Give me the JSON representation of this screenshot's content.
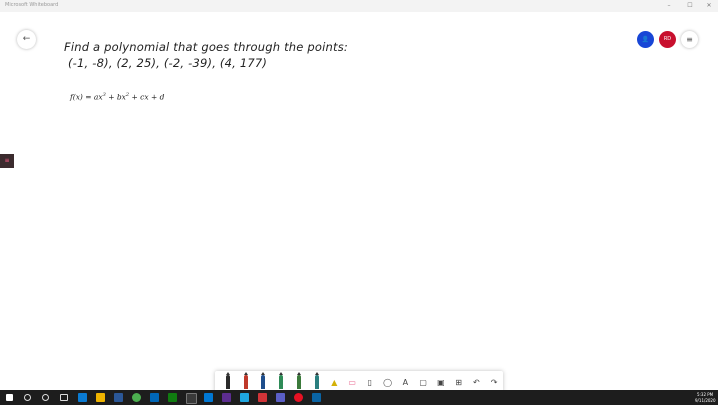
{
  "app": {
    "title": "Microsoft Whiteboard"
  },
  "window_controls": {
    "minimize": "–",
    "maximize": "☐",
    "close": "✕"
  },
  "header": {
    "back_glyph": "←",
    "user_glyph": "👤",
    "user_initials": "RD",
    "menu_glyph": "≡"
  },
  "colors": {
    "user_avatar": "#1846d6",
    "rd_avatar": "#c8102e",
    "taskbar": "#1d1d1d"
  },
  "board": {
    "line1": "Find a polynomial that goes through the points:",
    "line2": "(-1, -8), (2, 25), (-2, -39), (4, 177)",
    "formula_lhs": "f(x) = ax",
    "formula_exp1": "3",
    "formula_mid1": " + bx",
    "formula_exp2": "2",
    "formula_rest": " + cx + d"
  },
  "toolbar": {
    "pens": [
      {
        "name": "pen-black",
        "color": "#2b2b2b"
      },
      {
        "name": "pen-red",
        "color": "#c0392b"
      },
      {
        "name": "pen-blue",
        "color": "#1f4e8c"
      },
      {
        "name": "pen-green",
        "color": "#2e8b57"
      },
      {
        "name": "pen-darkgreen",
        "color": "#3b7a3b"
      },
      {
        "name": "pen-teal",
        "color": "#2a7f7f"
      }
    ],
    "highlighter_glyph": "▲",
    "eraser_glyph": "▭",
    "ruler_glyph": "▯",
    "lasso_glyph": "◯",
    "text_glyph": "A",
    "note_glyph": "▢",
    "image_glyph": "▣",
    "insert_glyph": "⊞",
    "undo_glyph": "↶",
    "redo_glyph": "↷"
  },
  "taskbar": {
    "time": "5:32 PM",
    "date": "9/11/2020"
  }
}
